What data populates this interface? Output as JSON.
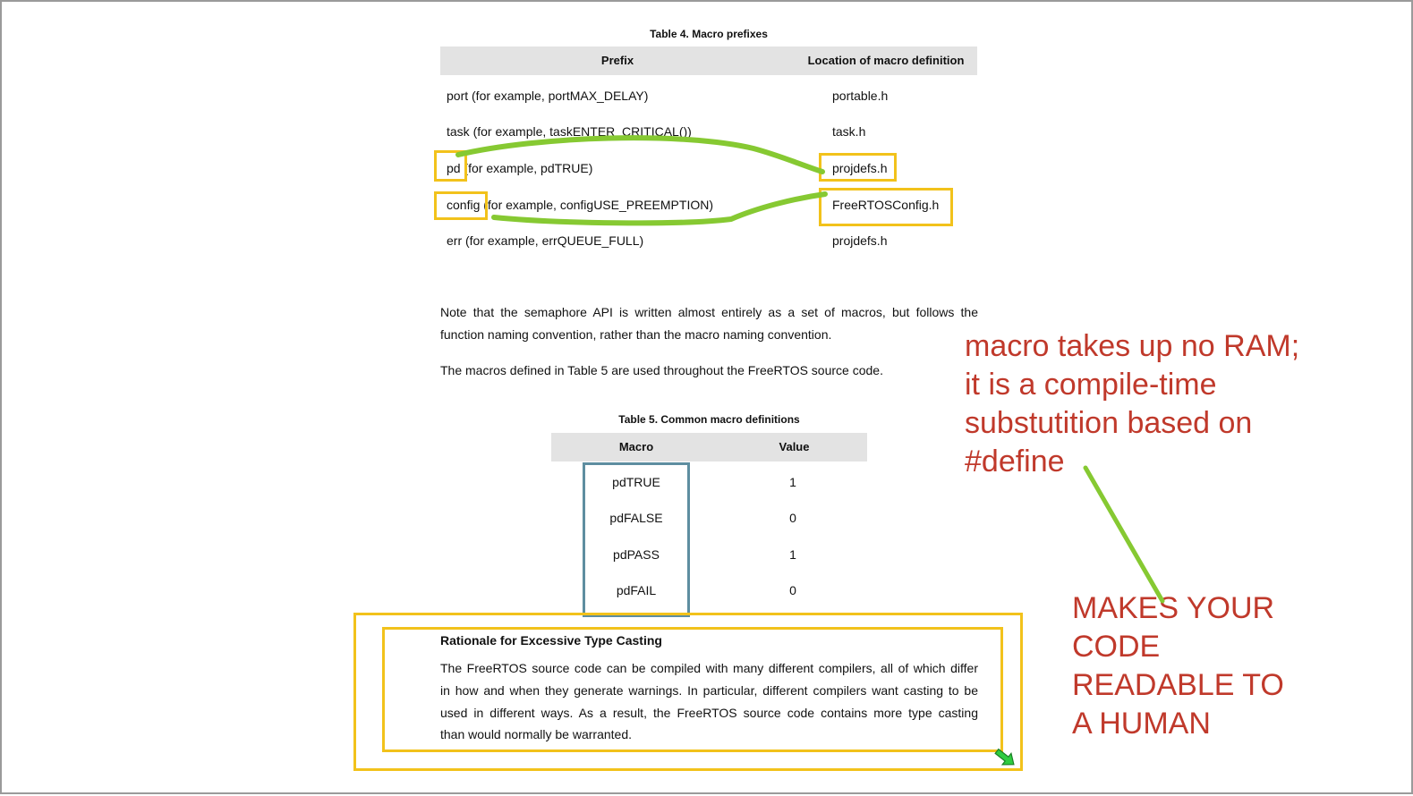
{
  "table4": {
    "caption": "Table 4.  Macro prefixes",
    "headers": {
      "prefix": "Prefix",
      "location": "Location of macro definition"
    },
    "rows": [
      {
        "prefix": "port (for example, portMAX_DELAY)",
        "location": "portable.h"
      },
      {
        "prefix": "task (for example, taskENTER_CRITICAL())",
        "location": "task.h"
      },
      {
        "prefix_key": "pd",
        "prefix_rest": " (for example, pdTRUE)",
        "location": "projdefs.h"
      },
      {
        "prefix_key": "config",
        "prefix_rest": " (for example, configUSE_PREEMPTION)",
        "location": "FreeRTOSConfig.h"
      },
      {
        "prefix": "err (for example, errQUEUE_FULL)",
        "location": "projdefs.h"
      }
    ]
  },
  "note_paragraph": {
    "line1": "Note that the semaphore API is written almost entirely as a set of macros, but follows the",
    "line2": "function naming convention, rather than the macro naming convention."
  },
  "macros_paragraph": "The macros defined in Table 5 are used throughout the FreeRTOS source code.",
  "table5": {
    "caption": "Table 5.  Common macro definitions",
    "headers": {
      "macro": "Macro",
      "value": "Value"
    },
    "rows": [
      {
        "macro": "pdTRUE",
        "value": "1"
      },
      {
        "macro": "pdFALSE",
        "value": "0"
      },
      {
        "macro": "pdPASS",
        "value": "1"
      },
      {
        "macro": "pdFAIL",
        "value": "0"
      }
    ]
  },
  "rationale": {
    "title": "Rationale for Excessive Type Casting",
    "lines": [
      "The FreeRTOS source code can be compiled with many different compilers, all of which differ",
      "in how and when they generate warnings.  In particular, different compilers want casting to be",
      "used in different ways.  As a result, the FreeRTOS source code contains more type casting",
      "than would normally be warranted."
    ]
  },
  "annotations": {
    "macro_note": [
      "macro takes up no RAM;",
      "it is a compile-time",
      "substutition based on",
      "#define"
    ],
    "readable_note": [
      "MAKES YOUR",
      "CODE",
      "READABLE TO",
      "A HUMAN"
    ]
  },
  "colors": {
    "highlight_box": "#f2c21b",
    "connector": "#86c932",
    "annotation_text": "#c0392b",
    "macro_box": "#5e8ea0",
    "header_bg": "#e3e3e3"
  },
  "icons": {
    "resize_handle": "green-arrow-icon"
  }
}
